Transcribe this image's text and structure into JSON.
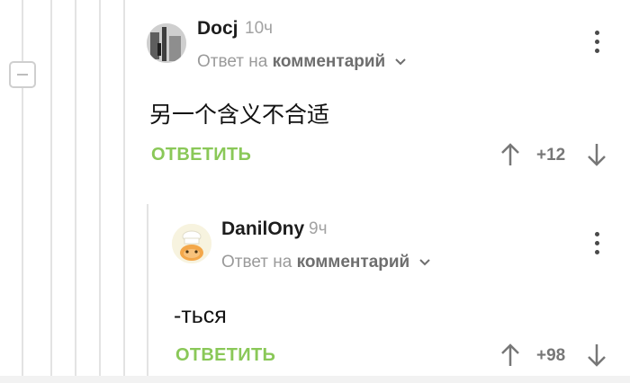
{
  "comments": [
    {
      "author": "Docj",
      "time": "10ч",
      "reply_prefix": "Ответ на",
      "reply_link": "комментарий",
      "body": "另一个含义不合适",
      "reply_label": "ОТВЕТИТЬ",
      "rating": "+12",
      "avatar_icon": "avatar-photo-icon"
    },
    {
      "author": "DanilOny",
      "time": "9ч",
      "reply_prefix": "Ответ на",
      "reply_link": "комментарий",
      "body": "-ться",
      "reply_label": "ОТВЕТИТЬ",
      "rating": "+98",
      "avatar_icon": "avatar-chef-icon"
    }
  ],
  "colors": {
    "accent_green": "#8ac858",
    "thread_line": "#e3e3e3",
    "meta_gray": "#9a9a9a"
  },
  "icons": [
    "collapse-thread-icon",
    "more-options-icon",
    "chevron-down-icon",
    "arrow-up-icon",
    "arrow-down-icon"
  ]
}
